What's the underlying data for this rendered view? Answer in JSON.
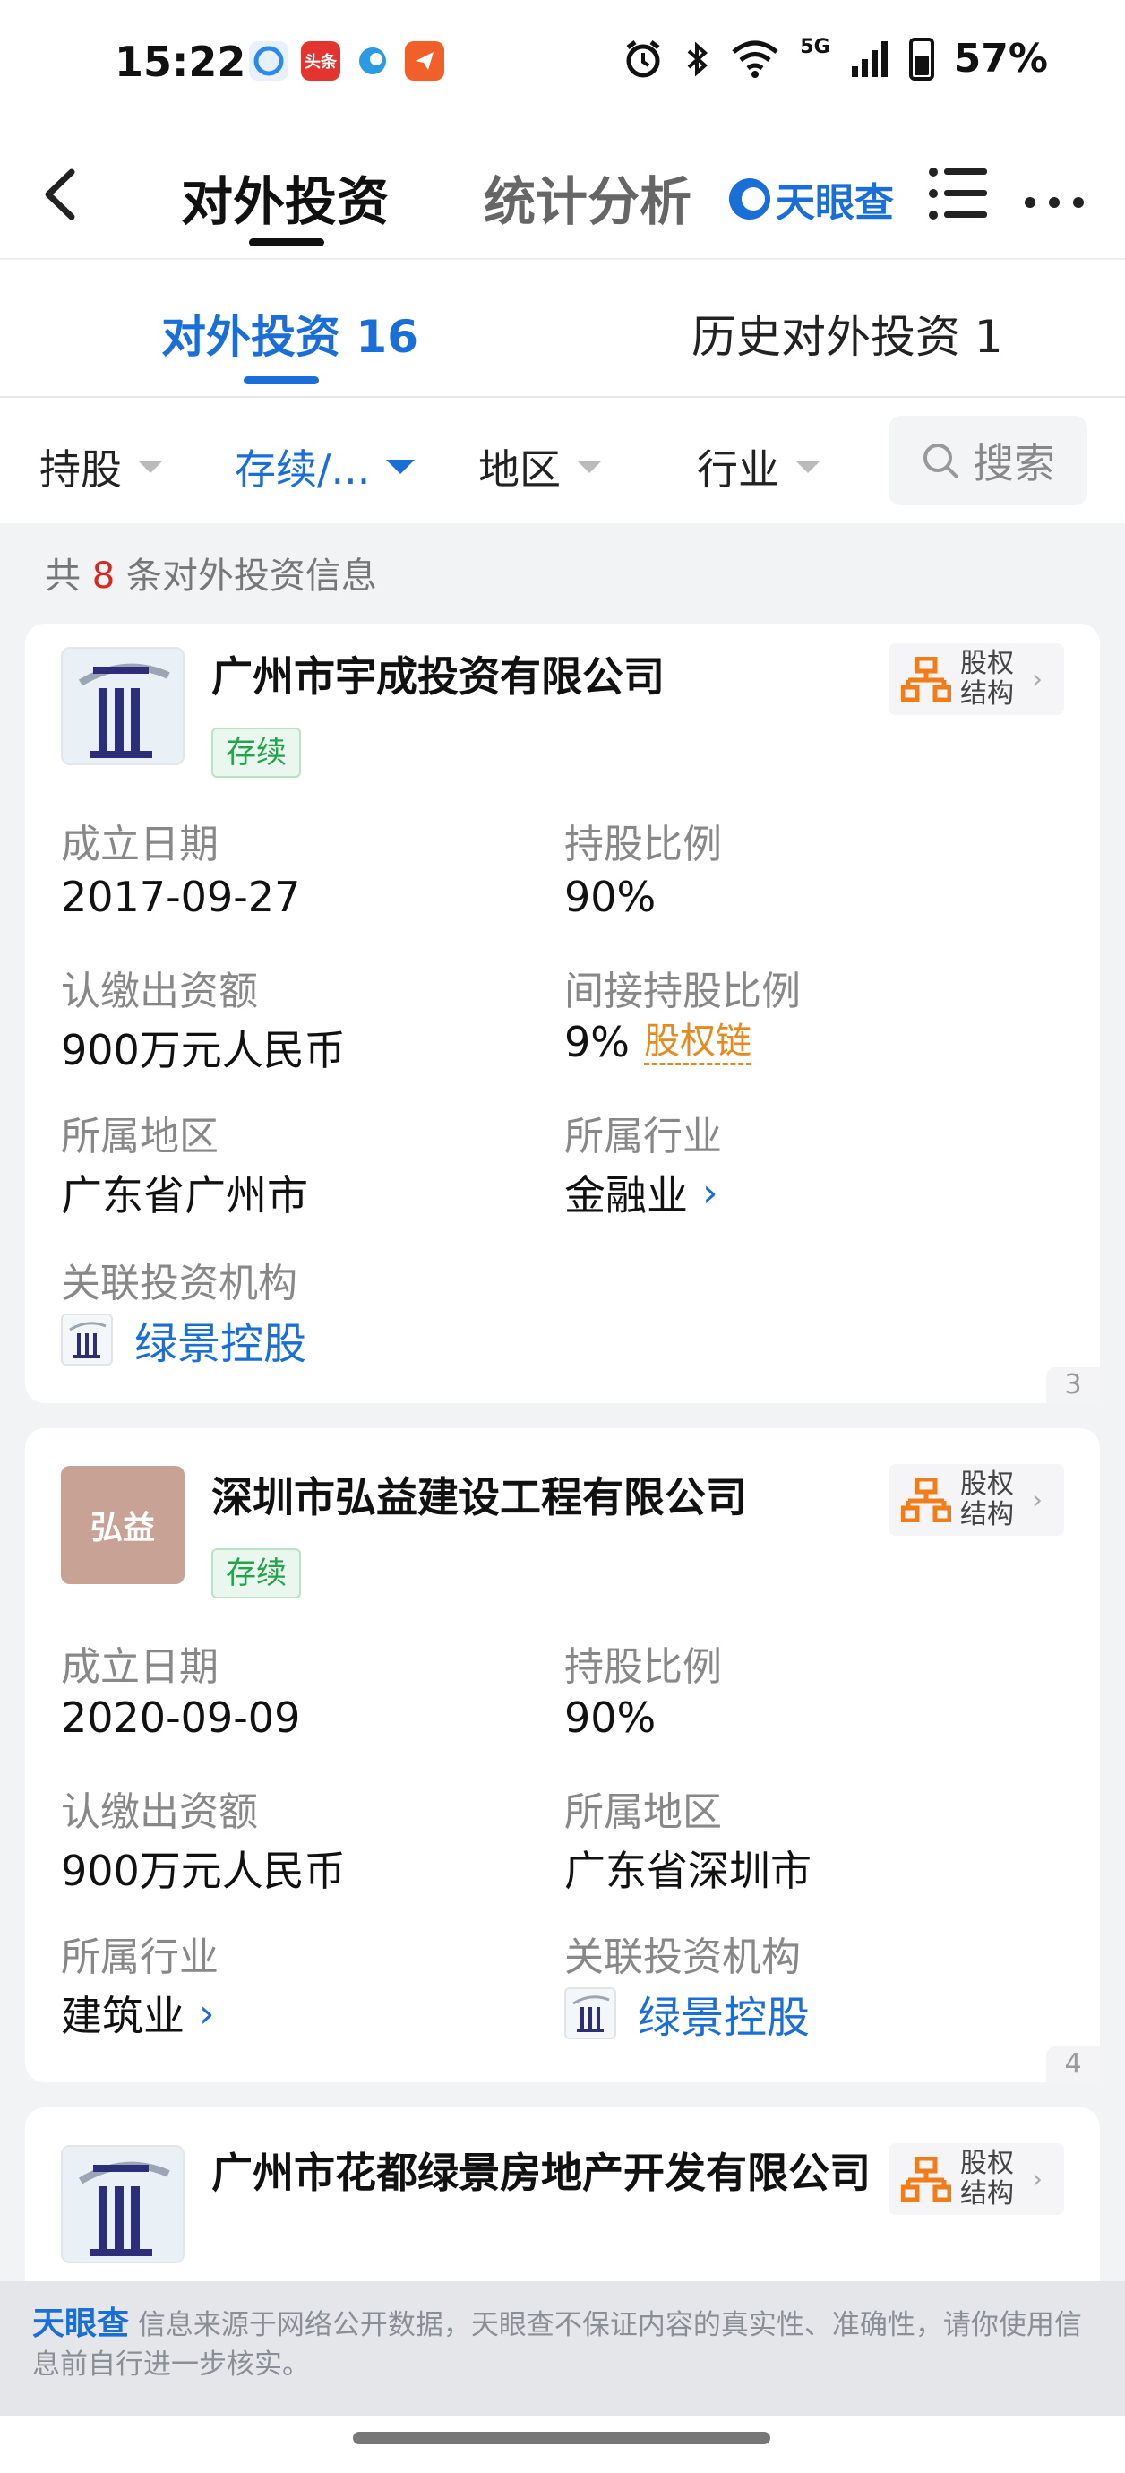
{
  "status_bar": {
    "time": "15:22",
    "battery": "57%",
    "network": "5G",
    "app_badge": "头条",
    "icons": [
      "alarm-icon",
      "bluetooth-icon",
      "wifi-icon",
      "signal-icon"
    ]
  },
  "nav": {
    "tab_invest": "对外投资",
    "tab_stats": "统计分析",
    "brand": "天眼查"
  },
  "sub_tabs": {
    "current": "对外投资 16",
    "history": "历史对外投资 1"
  },
  "filters": {
    "shareholding": "持股",
    "status": "存续/...",
    "region": "地区",
    "industry": "行业",
    "search": "搜索"
  },
  "summary": {
    "prefix": "共",
    "count": "8",
    "suffix": "条对外投资信息"
  },
  "cards": [
    {
      "name": "广州市宇成投资有限公司",
      "status": "存续",
      "equity_label": "股权结构",
      "fields": {
        "established_label": "成立日期",
        "established": "2017-09-27",
        "ratio_label": "持股比例",
        "ratio": "90%",
        "capital_label": "认缴出资额",
        "capital": "900万元人民币",
        "indirect_label": "间接持股比例",
        "indirect": "9%",
        "chain": "股权链",
        "region_label": "所属地区",
        "region": "广东省广州市",
        "industry_label": "所属行业",
        "industry": "金融业",
        "investor_label": "关联投资机构",
        "investor": "绿景控股"
      },
      "page": "3"
    },
    {
      "name": "深圳市弘益建设工程有限公司",
      "logo_text": "弘益",
      "status": "存续",
      "equity_label": "股权结构",
      "fields": {
        "established_label": "成立日期",
        "established": "2020-09-09",
        "ratio_label": "持股比例",
        "ratio": "90%",
        "capital_label": "认缴出资额",
        "capital": "900万元人民币",
        "region_label": "所属地区",
        "region": "广东省深圳市",
        "industry_label": "所属行业",
        "industry": "建筑业",
        "investor_label": "关联投资机构",
        "investor": "绿景控股"
      },
      "page": "4"
    },
    {
      "name": "广州市花都绿景房地产开发有限公司",
      "equity_label": "股权结构"
    }
  ],
  "disclaimer": {
    "brand": "天眼查",
    "text": "信息来源于网络公开数据，天眼查不保证内容的真实性、准确性，请你使用信息前自行进一步核实。"
  }
}
